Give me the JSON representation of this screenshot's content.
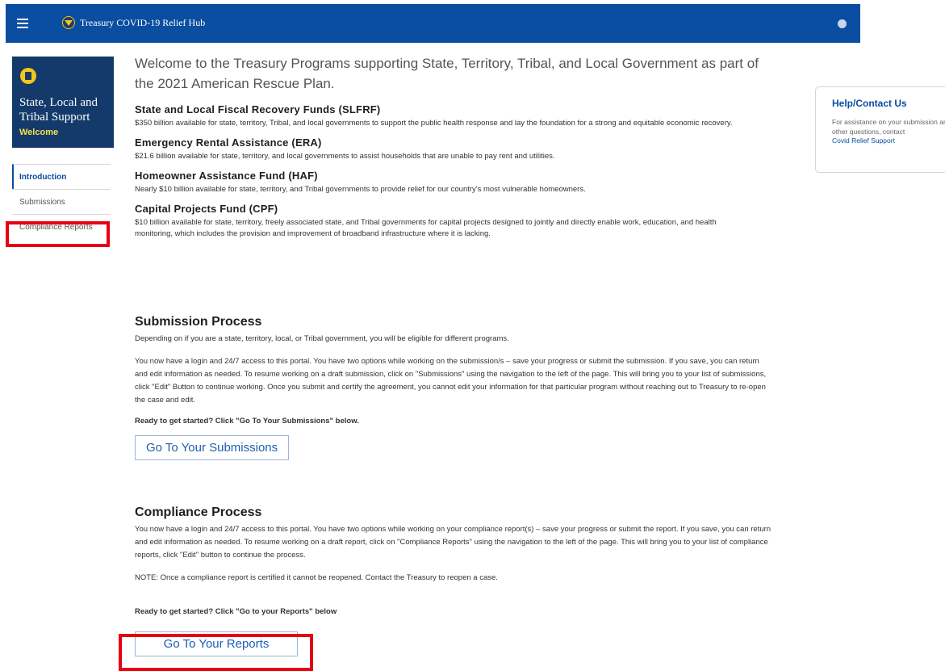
{
  "header": {
    "app_title": "Treasury COVID-19 Relief Hub",
    "menu_icon": "hamburger-icon",
    "brand_icon": "treasury-seal-icon",
    "user_icon": "user-avatar-icon",
    "bg_color": "#0a4ea2"
  },
  "sidebar": {
    "card_title": "State, Local and Tribal Support",
    "card_subtitle": "Welcome",
    "card_icon": "building-icon",
    "items": [
      {
        "label": "Introduction",
        "active": true
      },
      {
        "label": "Submissions",
        "active": false
      },
      {
        "label": "Compliance Reports",
        "active": false
      }
    ]
  },
  "main": {
    "headline": "Welcome to the Treasury Programs supporting State, Territory, Tribal, and Local Government as part of the 2021 American Rescue Plan.",
    "programs": [
      {
        "title": "State and Local Fiscal Recovery Funds (SLFRF)",
        "desc": "$350 billion available for state, territory, Tribal, and local governments to support the public health response and lay the foundation for a strong and equitable economic recovery."
      },
      {
        "title": "Emergency Rental Assistance (ERA)",
        "desc": "$21.6 billion available for state, territory, and local governments to assist households that are unable to pay rent and utilities."
      },
      {
        "title": "Homeowner Assistance Fund (HAF)",
        "desc": "Nearly $10 billion available for state, territory, and Tribal governments to provide relief for our country's most vulnerable homeowners."
      },
      {
        "title": "Capital Projects Fund (CPF)",
        "desc": "$10 billion available for state, territory, freely associated state, and Tribal governments for capital projects designed to jointly and directly enable work, education, and health monitoring, which includes the provision and improvement of broadband infrastructure where it is lacking."
      }
    ],
    "submission": {
      "title": "Submission Process",
      "intro": "Depending on if you are a state, territory, local, or Tribal government, you will be eligible for different programs.",
      "body": "You now have a login and 24/7 access to this portal. You have two options while working on the submission/s – save your progress or submit the submission. If you save, you can return and edit information as needed. To resume working on a draft submission, click on \"Submissions\" using the navigation to the left of the page. This will bring you to your list of submissions, click \"Edit\" Button to continue working. Once you submit and certify the agreement, you cannot edit your information for that particular program without reaching out to Treasury to re-open the case and edit.",
      "ready": "Ready to get started? Click \"Go To Your Submissions\" below.",
      "button": "Go To Your Submissions"
    },
    "compliance": {
      "title": "Compliance Process",
      "body": "You now have a login and 24/7 access to this portal. You have two options while working on your compliance report(s) – save your progress or submit the report. If you save, you can return and edit information as needed. To resume working on a draft report, click on \"Compliance Reports\" using the navigation to the left of the page. This will bring you to your list of compliance reports, click \"Edit\" button to continue the process.",
      "note": "NOTE: Once a compliance report is certified it cannot be reopened. Contact the Treasury to reopen a case.",
      "ready": "Ready to get started? Click \"Go to your Reports\" below",
      "button": "Go To Your Reports"
    }
  },
  "help": {
    "title": "Help/Contact Us",
    "text": "For assistance on your submission and other questions, contact",
    "link": "Covid Relief Support"
  },
  "annotations": {
    "highlight_color": "#e60012"
  }
}
